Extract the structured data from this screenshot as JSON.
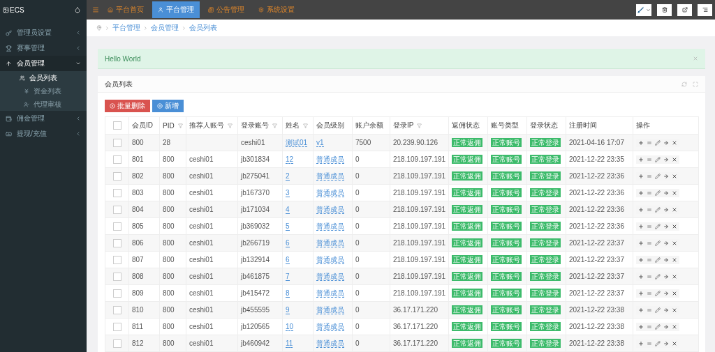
{
  "header": {
    "logo": "ECS",
    "nav": [
      {
        "label": "平台首页",
        "selected": false
      },
      {
        "label": "平台管理",
        "selected": true
      },
      {
        "label": "公告管理",
        "selected": false
      },
      {
        "label": "系统设置",
        "selected": false
      }
    ]
  },
  "sidebar": {
    "items": [
      {
        "label": "管理员设置",
        "expanded": false
      },
      {
        "label": "赛事管理",
        "expanded": false
      },
      {
        "label": "会员管理",
        "expanded": true,
        "children": [
          {
            "label": "会员列表",
            "selected": true
          },
          {
            "label": "资金列表",
            "selected": false
          },
          {
            "label": "代理审核",
            "selected": false
          }
        ]
      },
      {
        "label": "佣金管理",
        "expanded": false
      },
      {
        "label": "提现/充值",
        "expanded": false
      }
    ]
  },
  "breadcrumb": [
    "平台管理",
    "会员管理",
    "会员列表"
  ],
  "alert": {
    "text": "Hello World"
  },
  "panel": {
    "title": "会员列表",
    "buttons": [
      {
        "kind": "danger",
        "label": "批量删除"
      },
      {
        "kind": "primary",
        "label": "新增"
      }
    ]
  },
  "table": {
    "select_all_checked": false,
    "columns": [
      {
        "label": "会员ID",
        "filter": false
      },
      {
        "label": "PID",
        "filter": true
      },
      {
        "label": "推荐人账号",
        "filter": true
      },
      {
        "label": "登录账号",
        "filter": true
      },
      {
        "label": "姓名",
        "filter": true
      },
      {
        "label": "会员级别",
        "filter": false
      },
      {
        "label": "账户余额",
        "filter": false
      },
      {
        "label": "登录IP",
        "filter": true
      },
      {
        "label": "返佣状态",
        "filter": false
      },
      {
        "label": "账号类型",
        "filter": false
      },
      {
        "label": "登录状态",
        "filter": false
      },
      {
        "label": "注册时间",
        "filter": false
      },
      {
        "label": "操作",
        "filter": false
      }
    ],
    "rows": [
      {
        "checked": false,
        "id": "800",
        "pid": "28",
        "referrer": "",
        "account": "ceshi01",
        "name": "测试01",
        "level": "v1",
        "balance": "7500",
        "ip": "20.239.90.126",
        "rebate": "正常返佣",
        "type": "正常账号",
        "login": "正常登录",
        "registered": "2021-04-16 17:07"
      },
      {
        "checked": false,
        "id": "801",
        "pid": "800",
        "referrer": "ceshi01",
        "account": "jb301834",
        "name": "12",
        "level": "普通成员",
        "balance": "0",
        "ip": "218.109.197.191",
        "rebate": "正常返佣",
        "type": "正常账号",
        "login": "正常登录",
        "registered": "2021-12-22 23:35"
      },
      {
        "checked": false,
        "id": "802",
        "pid": "800",
        "referrer": "ceshi01",
        "account": "jb275041",
        "name": "2",
        "level": "普通成员",
        "balance": "0",
        "ip": "218.109.197.191",
        "rebate": "正常返佣",
        "type": "正常账号",
        "login": "正常登录",
        "registered": "2021-12-22 23:36"
      },
      {
        "checked": false,
        "id": "803",
        "pid": "800",
        "referrer": "ceshi01",
        "account": "jb167370",
        "name": "3",
        "level": "普通成员",
        "balance": "0",
        "ip": "218.109.197.191",
        "rebate": "正常返佣",
        "type": "正常账号",
        "login": "正常登录",
        "registered": "2021-12-22 23:36"
      },
      {
        "checked": false,
        "id": "804",
        "pid": "800",
        "referrer": "ceshi01",
        "account": "jb171034",
        "name": "4",
        "level": "普通成员",
        "balance": "0",
        "ip": "218.109.197.191",
        "rebate": "正常返佣",
        "type": "正常账号",
        "login": "正常登录",
        "registered": "2021-12-22 23:36"
      },
      {
        "checked": false,
        "id": "805",
        "pid": "800",
        "referrer": "ceshi01",
        "account": "jb369032",
        "name": "5",
        "level": "普通成员",
        "balance": "0",
        "ip": "218.109.197.191",
        "rebate": "正常返佣",
        "type": "正常账号",
        "login": "正常登录",
        "registered": "2021-12-22 23:36"
      },
      {
        "checked": false,
        "id": "806",
        "pid": "800",
        "referrer": "ceshi01",
        "account": "jb266719",
        "name": "6",
        "level": "普通成员",
        "balance": "0",
        "ip": "218.109.197.191",
        "rebate": "正常返佣",
        "type": "正常账号",
        "login": "正常登录",
        "registered": "2021-12-22 23:37"
      },
      {
        "checked": false,
        "id": "807",
        "pid": "800",
        "referrer": "ceshi01",
        "account": "jb132914",
        "name": "6",
        "level": "普通成员",
        "balance": "0",
        "ip": "218.109.197.191",
        "rebate": "正常返佣",
        "type": "正常账号",
        "login": "正常登录",
        "registered": "2021-12-22 23:37"
      },
      {
        "checked": false,
        "id": "808",
        "pid": "800",
        "referrer": "ceshi01",
        "account": "jb461875",
        "name": "7",
        "level": "普通成员",
        "balance": "0",
        "ip": "218.109.197.191",
        "rebate": "正常返佣",
        "type": "正常账号",
        "login": "正常登录",
        "registered": "2021-12-22 23:37"
      },
      {
        "checked": false,
        "id": "809",
        "pid": "800",
        "referrer": "ceshi01",
        "account": "jb415472",
        "name": "8",
        "level": "普通成员",
        "balance": "0",
        "ip": "218.109.197.191",
        "rebate": "正常返佣",
        "type": "正常账号",
        "login": "正常登录",
        "registered": "2021-12-22 23:37"
      },
      {
        "checked": false,
        "id": "810",
        "pid": "800",
        "referrer": "ceshi01",
        "account": "jb455595",
        "name": "9",
        "level": "普通成员",
        "balance": "0",
        "ip": "36.17.171.220",
        "rebate": "正常返佣",
        "type": "正常账号",
        "login": "正常登录",
        "registered": "2021-12-22 23:38"
      },
      {
        "checked": false,
        "id": "811",
        "pid": "800",
        "referrer": "ceshi01",
        "account": "jb120565",
        "name": "10",
        "level": "普通成员",
        "balance": "0",
        "ip": "36.17.171.220",
        "rebate": "正常返佣",
        "type": "正常账号",
        "login": "正常登录",
        "registered": "2021-12-22 23:38"
      },
      {
        "checked": false,
        "id": "812",
        "pid": "800",
        "referrer": "ceshi01",
        "account": "jb460942",
        "name": "11",
        "level": "普通成员",
        "balance": "0",
        "ip": "36.17.171.220",
        "rebate": "正常返佣",
        "type": "正常账号",
        "login": "正常登录",
        "registered": "2021-12-22 23:38"
      }
    ]
  }
}
